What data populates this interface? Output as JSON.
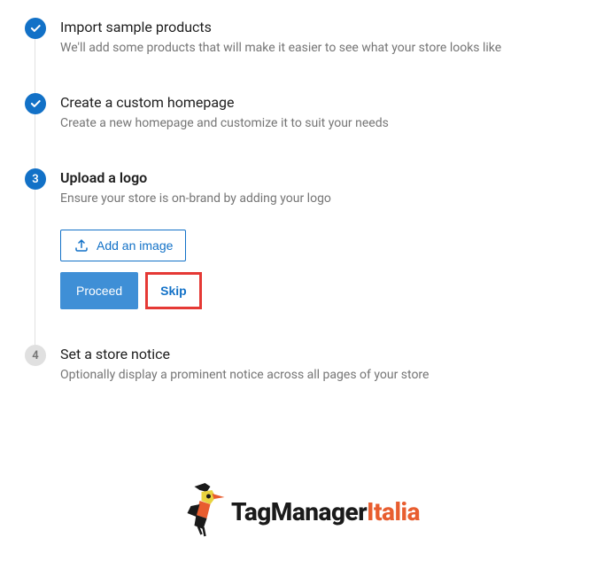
{
  "steps": [
    {
      "title": "Import sample products",
      "desc": "We'll add some products that will make it easier to see what your store looks like"
    },
    {
      "title": "Create a custom homepage",
      "desc": "Create a new homepage and customize it to suit your needs"
    },
    {
      "number": "3",
      "title": "Upload a logo",
      "desc": "Ensure your store is on-brand by adding your logo",
      "add_image_label": "Add an image",
      "proceed_label": "Proceed",
      "skip_label": "Skip"
    },
    {
      "number": "4",
      "title": "Set a store notice",
      "desc": "Optionally display a prominent notice across all pages of your store"
    }
  ],
  "brand": {
    "name_part1": "TagManager",
    "name_part2": "Italia"
  }
}
